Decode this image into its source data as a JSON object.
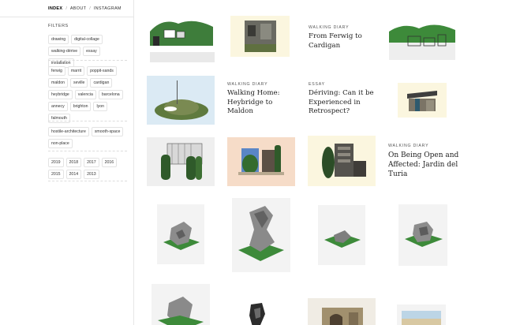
{
  "nav": {
    "items": [
      "INDEX",
      "ABOUT",
      "INSTAGRAM"
    ],
    "separator": "/"
  },
  "filters": {
    "title": "FILTERS",
    "group1": [
      "drawing",
      "digital-collage",
      "walking-dérive",
      "essay",
      "installation"
    ],
    "group2": [
      "ferwig",
      "marrit",
      "poppit-sands",
      "maldon",
      "seville",
      "cardigan",
      "heybridge",
      "valencia",
      "barcelona",
      "annecy",
      "brighton",
      "lyon",
      "falmouth"
    ],
    "group3": [
      "hostile-architecture",
      "smooth-space",
      "non-place"
    ],
    "group4": [
      "2019",
      "2018",
      "2017",
      "2016",
      "2015",
      "2014",
      "2013"
    ]
  },
  "posts": [
    {
      "kicker": "WALKING DIARY",
      "title": "From Ferwig to Cardigan"
    },
    {
      "kicker": "WALKING DIARY",
      "title": "Walking Home: Heybridge to Maldon"
    },
    {
      "kicker": "ESSAY",
      "title": "Dériving: Can it be Experienced in Retrospect?"
    },
    {
      "kicker": "WALKING DIARY",
      "title": "On Being Open and Affected: Jardin del Turia"
    }
  ],
  "thumbnails": [
    "digital-collage-hillside",
    "collage-ruin-cream",
    "collage-fences-hill",
    "collage-mound-blue",
    "collage-shelter-cream",
    "collage-house-hedges",
    "collage-tree-peach",
    "collage-tower-cream",
    "sculpture-1",
    "sculpture-2",
    "sculpture-3",
    "sculpture-4",
    "sculpture-5",
    "sculpture-6",
    "collage-arch",
    "collage-beach"
  ],
  "colors": {
    "sidebar_border": "#e6e6e6",
    "tag_border": "#e3e3e3",
    "cream": "#fbf6df",
    "peach": "#f6dcc8",
    "pale_blue": "#dbeaf4",
    "grass": "#3d8a3a"
  }
}
